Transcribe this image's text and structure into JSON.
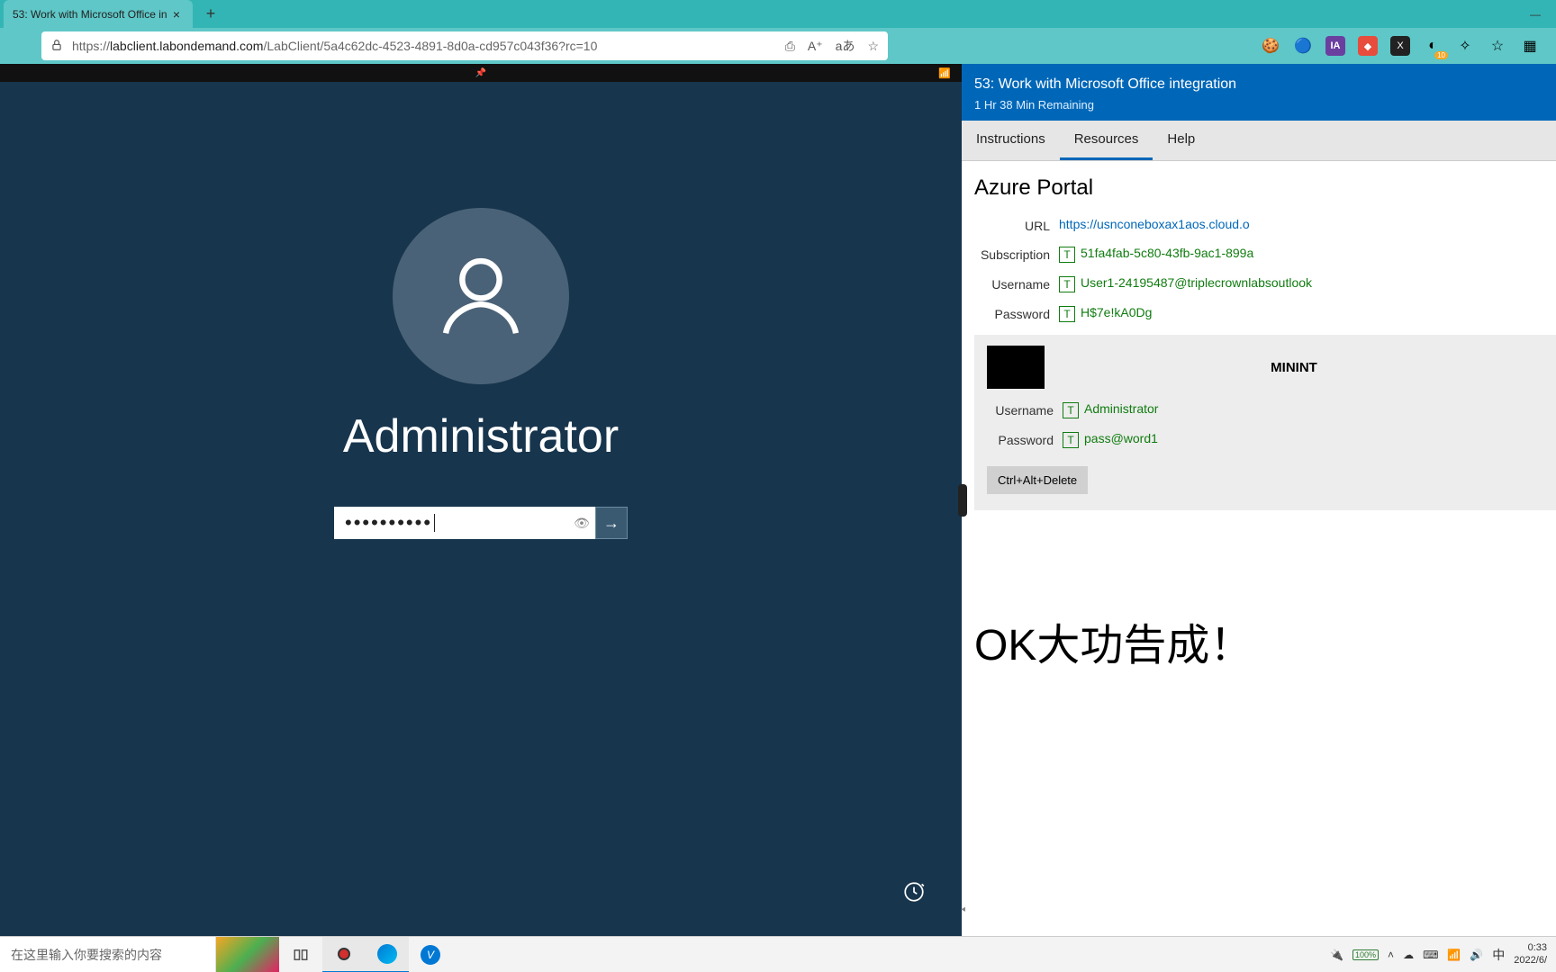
{
  "browser": {
    "tab_title": "53: Work with Microsoft Office in",
    "url_prefix": "https://",
    "url_host": "labclient.labondemand.com",
    "url_path": "/LabClient/5a4c62dc-4523-4891-8d0a-cd957c043f36?rc=10",
    "toolbar_badge": "10"
  },
  "vm": {
    "login_user": "Administrator",
    "password_dots": "••••••••••"
  },
  "lab": {
    "title": "53: Work with Microsoft Office integration",
    "time_remaining": "1 Hr 38 Min Remaining",
    "tabs": {
      "instructions": "Instructions",
      "resources": "Resources",
      "help": "Help"
    },
    "section_title": "Azure Portal",
    "url_label": "URL",
    "url_value": "https://usnconeboxax1aos.cloud.o",
    "subscription_label": "Subscription",
    "subscription_value": "51fa4fab-5c80-43fb-9ac1-899a",
    "username_label": "Username",
    "username_value": "User1-24195487@triplecrownlabsoutlook",
    "password_label": "Password",
    "password_value": "H$7e!kA0Dg",
    "type_badge": "T",
    "vm_name": "MININT",
    "vm_username_label": "Username",
    "vm_username_value": "Administrator",
    "vm_password_label": "Password",
    "vm_password_value": "pass@word1",
    "cad_button": "Ctrl+Alt+Delete",
    "big_text": "OK大功告成！"
  },
  "taskbar": {
    "search_placeholder": "在这里输入你要搜索的内容",
    "battery": "100%",
    "ime": "中",
    "time": "0:33",
    "date": "2022/6/"
  }
}
